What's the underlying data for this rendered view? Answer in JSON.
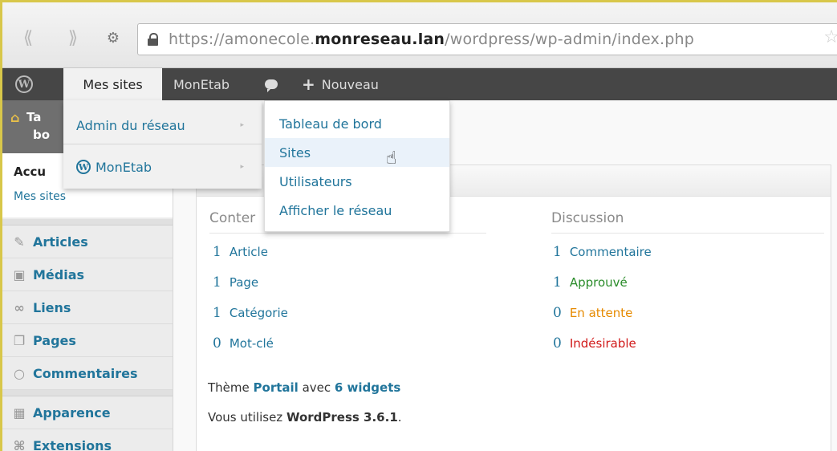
{
  "browser": {
    "url_prefix": "https://amonecole.",
    "url_domain": "monreseau.lan",
    "url_path": "/wordpress/wp-admin/index.php"
  },
  "adminbar": {
    "wp_logo": "W",
    "mes_sites": "Mes sites",
    "site_name": "MonEtab",
    "new_plus": "+",
    "new_label": "Nouveau"
  },
  "dropdown_sites": {
    "items": [
      {
        "label": "Admin du réseau"
      },
      {
        "label": "MonEtab"
      }
    ]
  },
  "dropdown_network": {
    "items": [
      {
        "label": "Tableau de bord"
      },
      {
        "label": "Sites"
      },
      {
        "label": "Utilisateurs"
      },
      {
        "label": "Afficher le réseau"
      }
    ]
  },
  "sidebar": {
    "dashboard_line1": "Ta",
    "dashboard_line2": "bo",
    "accueil": "Accu",
    "mes_sites": "Mes sites",
    "items": [
      {
        "label": "Articles",
        "icon": "pin-icon"
      },
      {
        "label": "Médias",
        "icon": "media-icon"
      },
      {
        "label": "Liens",
        "icon": "links-icon"
      },
      {
        "label": "Pages",
        "icon": "pages-icon"
      },
      {
        "label": "Commentaires",
        "icon": "comments-icon"
      },
      {
        "label": "Apparence",
        "icon": "appearance-icon"
      },
      {
        "label": "Extensions",
        "icon": "plugins-icon"
      }
    ]
  },
  "right_now": {
    "content_heading": "Conter",
    "discussion_heading": "Discussion",
    "content_rows": [
      {
        "num": "1",
        "label": "Article"
      },
      {
        "num": "1",
        "label": "Page"
      },
      {
        "num": "1",
        "label": "Catégorie"
      },
      {
        "num": "0",
        "label": "Mot-clé"
      }
    ],
    "discussion_rows": [
      {
        "num": "1",
        "label": "Commentaire",
        "color": "#21759b"
      },
      {
        "num": "1",
        "label": "Approuvé",
        "color": "#2a8c2a"
      },
      {
        "num": "0",
        "label": "En attente",
        "color": "#e68a00"
      },
      {
        "num": "0",
        "label": "Indésirable",
        "color": "#d11a1a"
      }
    ],
    "theme_prefix": "Thème ",
    "theme_name": "Portail",
    "theme_mid": " avec ",
    "theme_widgets": "6 widgets",
    "version_prefix": "Vous utilisez ",
    "version_name": "WordPress 3.6.1",
    "version_suffix": "."
  }
}
